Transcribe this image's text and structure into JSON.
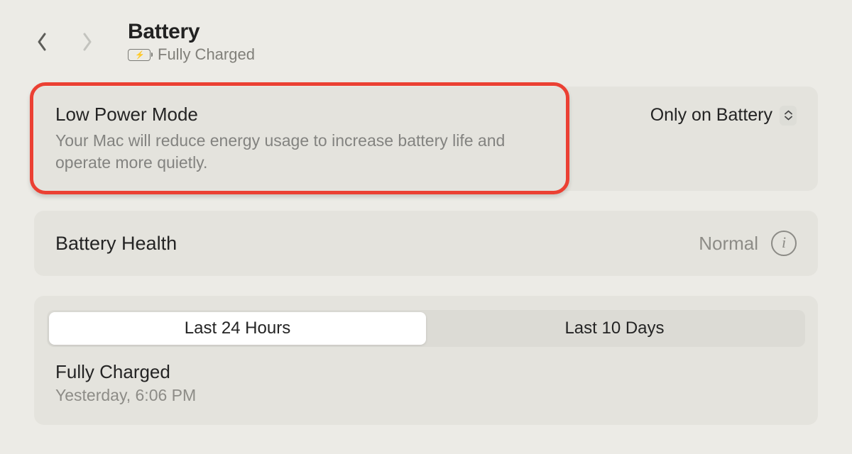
{
  "header": {
    "title": "Battery",
    "status": "Fully Charged"
  },
  "low_power": {
    "title": "Low Power Mode",
    "description": "Your Mac will reduce energy usage to increase battery life and operate more quietly.",
    "selected": "Only on Battery"
  },
  "health": {
    "title": "Battery Health",
    "status": "Normal"
  },
  "usage": {
    "tabs": [
      "Last 24 Hours",
      "Last 10 Days"
    ],
    "active_tab": 0,
    "charge_status": "Fully Charged",
    "charge_time": "Yesterday, 6:06 PM"
  }
}
